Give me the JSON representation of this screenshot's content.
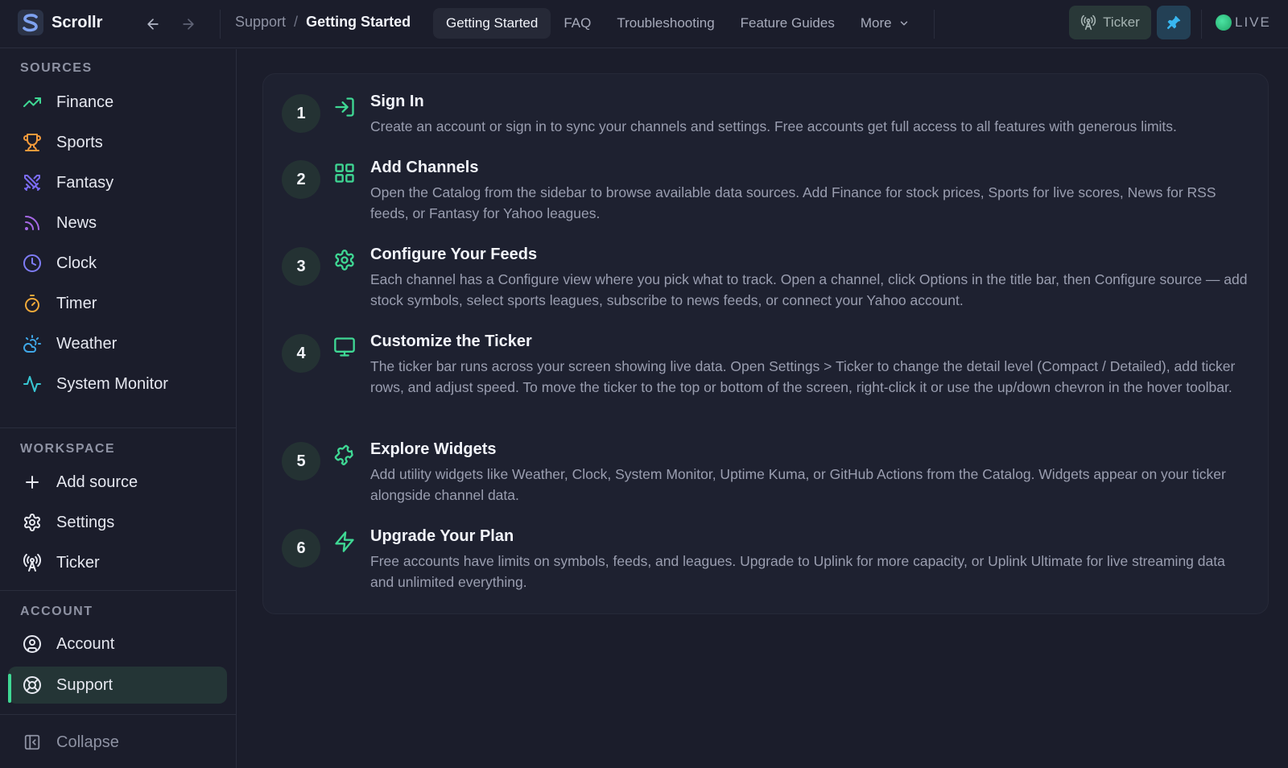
{
  "app": {
    "name": "Scrollr"
  },
  "breadcrumb": {
    "parent": "Support",
    "separator": "/",
    "current": "Getting Started"
  },
  "tabs": [
    {
      "label": "Getting Started",
      "active": true
    },
    {
      "label": "FAQ"
    },
    {
      "label": "Troubleshooting"
    },
    {
      "label": "Feature Guides"
    },
    {
      "label": "More"
    }
  ],
  "header": {
    "ticker_label": "Ticker",
    "live_label": "LIVE"
  },
  "sidebar": {
    "sources_title": "SOURCES",
    "sources": [
      {
        "label": "Finance",
        "icon": "trending-up-icon"
      },
      {
        "label": "Sports",
        "icon": "trophy-icon"
      },
      {
        "label": "Fantasy",
        "icon": "swords-icon"
      },
      {
        "label": "News",
        "icon": "rss-icon"
      },
      {
        "label": "Clock",
        "icon": "clock-icon"
      },
      {
        "label": "Timer",
        "icon": "timer-icon"
      },
      {
        "label": "Weather",
        "icon": "cloud-sun-icon"
      },
      {
        "label": "System Monitor",
        "icon": "activity-icon"
      }
    ],
    "workspace_title": "WORKSPACE",
    "workspace": [
      {
        "label": "Add source",
        "icon": "plus-icon"
      },
      {
        "label": "Settings",
        "icon": "gear-icon"
      },
      {
        "label": "Ticker",
        "icon": "radio-tower-icon"
      }
    ],
    "account_title": "ACCOUNT",
    "account": [
      {
        "label": "Account",
        "icon": "user-circle-icon"
      },
      {
        "label": "Support",
        "icon": "lifebuoy-icon",
        "active": true
      }
    ],
    "collapse_label": "Collapse"
  },
  "steps": [
    {
      "number": "1",
      "title": "Sign In",
      "icon": "log-in-icon",
      "description": "Create an account or sign in to sync your channels and settings. Free accounts get full access to all features with generous limits."
    },
    {
      "number": "2",
      "title": "Add Channels",
      "icon": "grid-icon",
      "description": "Open the Catalog from the sidebar to browse available data sources. Add Finance for stock prices, Sports for live scores, News for RSS feeds, or Fantasy for Yahoo leagues."
    },
    {
      "number": "3",
      "title": "Configure Your Feeds",
      "icon": "gear-icon",
      "description": "Each channel has a Configure view where you pick what to track. Open a channel, click Options in the title bar, then Configure source — add stock symbols, select sports leagues, subscribe to news feeds, or connect your Yahoo account."
    },
    {
      "number": "4",
      "title": "Customize the Ticker",
      "icon": "monitor-icon",
      "description": "The ticker bar runs across your screen showing live data. Open Settings > Ticker to change the detail level (Compact / Detailed), add ticker rows, and adjust speed. To move the ticker to the top or bottom of the screen, right-click it or use the up/down chevron in the hover toolbar."
    },
    {
      "number": "5",
      "title": "Explore Widgets",
      "icon": "puzzle-icon",
      "description": "Add utility widgets like Weather, Clock, System Monitor, Uptime Kuma, or GitHub Actions from the Catalog. Widgets appear on your ticker alongside channel data."
    },
    {
      "number": "6",
      "title": "Upgrade Your Plan",
      "icon": "zap-icon",
      "description": "Free accounts have limits on symbols, feeds, and leagues. Upgrade to Uplink for more capacity, or Uplink Ultimate for live streaming data and unlimited everything."
    }
  ],
  "colors": {
    "accent": "#3fd894",
    "background": "#1b1d2b",
    "card": "#1e2130",
    "muted_text": "#9a9eb0"
  }
}
